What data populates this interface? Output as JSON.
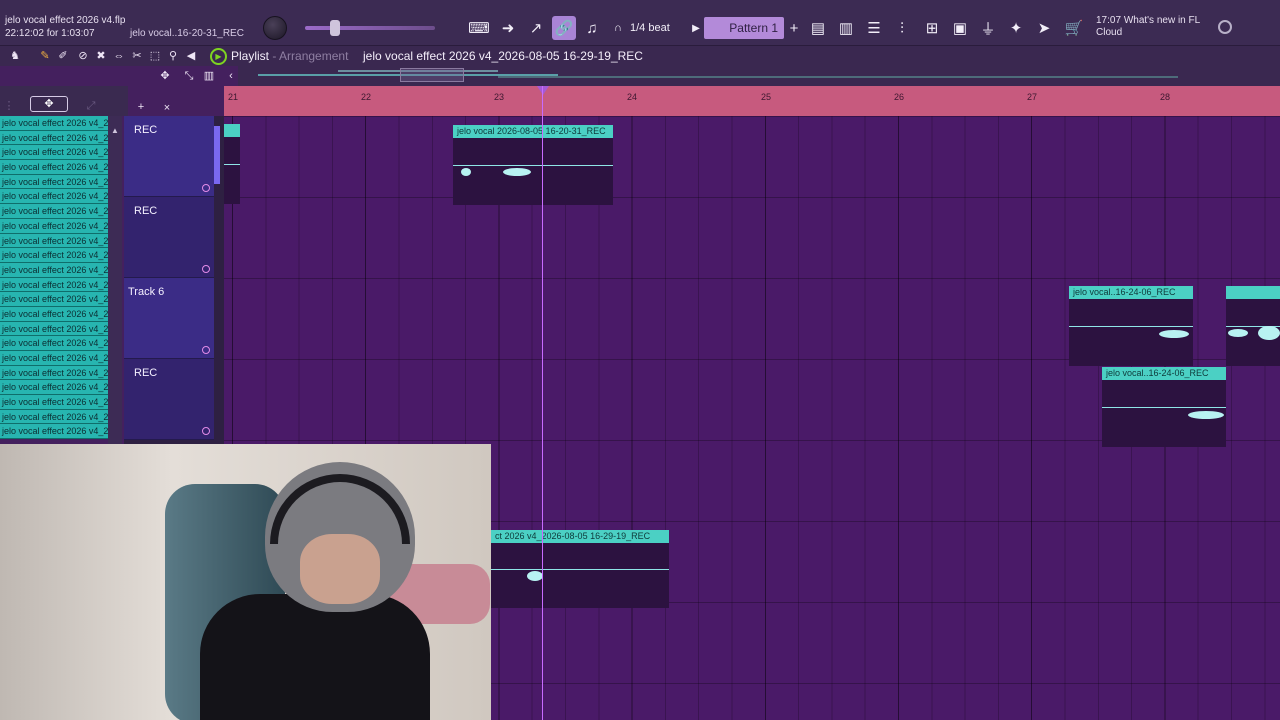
{
  "project": {
    "file_name": "jelo vocal effect 2026 v4.flp",
    "time_line": "22:12:02 for 1:03:07",
    "hint": "jelo vocal..16-20-31_REC"
  },
  "toolbar": {
    "snap": "1/4 beat",
    "pattern": "Pattern 1",
    "news_time": "17:07",
    "news_title": "What's new in FL",
    "news_sub": "Cloud"
  },
  "playlist": {
    "title": "Playlist",
    "sep": " - ",
    "mode": "Arrangement",
    "file": "jelo vocal effect 2026 v4_2026-08-05 16-29-19_REC",
    "bars": [
      "21",
      "22",
      "23",
      "24",
      "25",
      "26",
      "27",
      "28"
    ]
  },
  "browser": {
    "items": [
      "jelo vocal effect 2026 v4_2",
      "jelo vocal effect 2026 v4_2",
      "jelo vocal effect 2026 v4_2",
      "jelo vocal effect 2026 v4_2",
      "jelo vocal effect 2026 v4_2",
      "jelo vocal effect 2026 v4_2",
      "jelo vocal effect 2026 v4_2",
      "jelo vocal effect 2026 v4_2",
      "jelo vocal effect 2026 v4_2",
      "jelo vocal effect 2026 v4_2",
      "jelo vocal effect 2026 v4_2",
      "jelo vocal effect 2026 v4_2",
      "jelo vocal effect 2026 v4_2",
      "jelo vocal effect 2026 v4_2",
      "jelo vocal effect 2026 v4_2",
      "jelo vocal effect 2026 v4_2",
      "jelo vocal effect 2026 v4_2",
      "jelo vocal effect 2026 v4_2",
      "jelo vocal effect 2026 v4_2",
      "jelo vocal effect 2026 v4_2",
      "jelo vocal effect 2026 v4_2",
      "jelo vocal effect 2026 v4_2"
    ]
  },
  "tracks": [
    {
      "name": "REC"
    },
    {
      "name": "REC"
    },
    {
      "name": "Track 6"
    },
    {
      "name": "REC"
    }
  ],
  "clips": {
    "c1": "jelo vocal 2026-08-05 16-20-31_REC",
    "c2": "jelo vocal..16-24-06_REC",
    "c3": "jelo vocal..16-24-06_REC",
    "c4": "ct 2026 v4_2026-08-05 16-29-19_REC"
  },
  "colors": {
    "ruler": "#c75a7e",
    "clip_header": "#4bd0c4",
    "playhead": "#c86bff"
  }
}
